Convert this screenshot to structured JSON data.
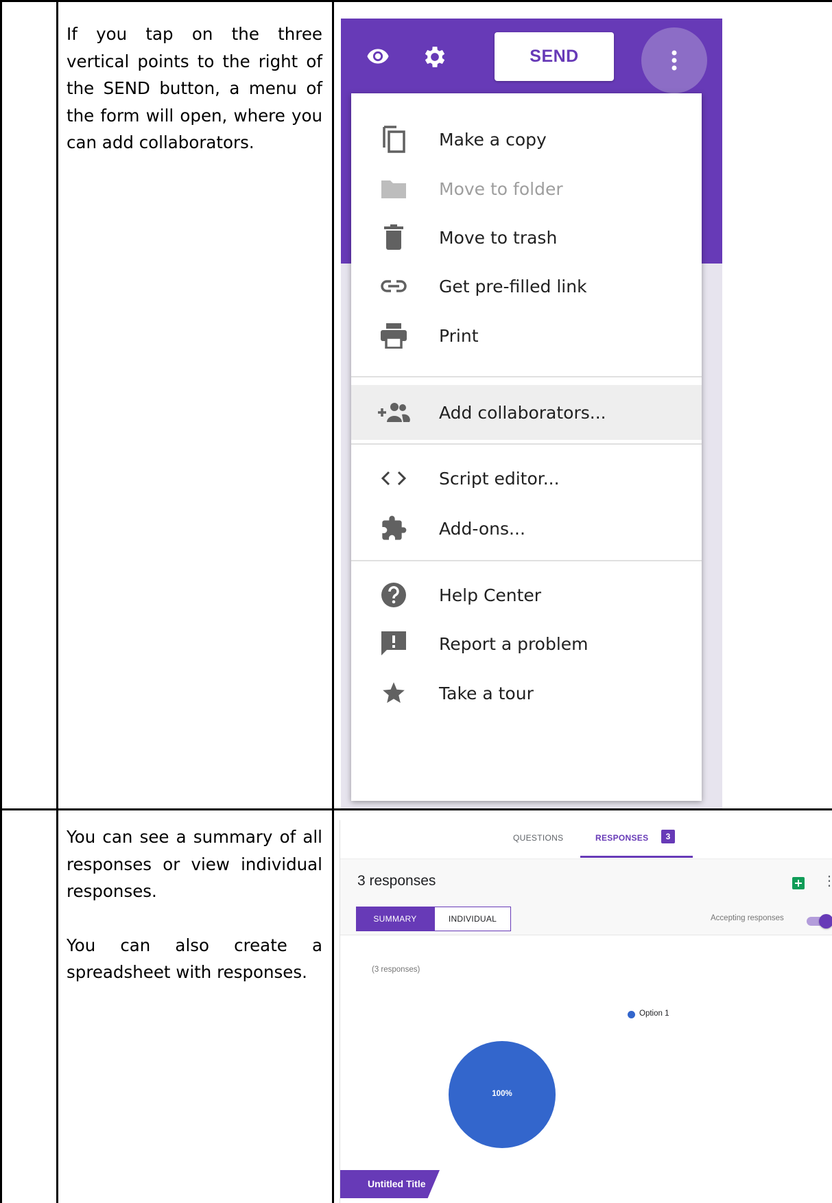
{
  "row1": {
    "text": "If you tap on the three vertical points to the right of the SEND button, a menu of the form will open, where you can add collaborators."
  },
  "row2": {
    "text1": "You can see a summary of all responses or view individual responses.",
    "text2": "You can also create a spreadsheet with responses."
  },
  "form_menu": {
    "toolbar": {
      "preview_icon": "eye-icon",
      "settings_icon": "gear-icon",
      "send_label": "SEND",
      "more_icon": "vertical-dots-icon"
    },
    "items": [
      {
        "label": "Make a copy",
        "icon": "copy-icon",
        "disabled": false
      },
      {
        "label": "Move to folder",
        "icon": "folder-icon",
        "disabled": true
      },
      {
        "label": "Move to trash",
        "icon": "trash-icon",
        "disabled": false
      },
      {
        "label": "Get pre-filled link",
        "icon": "link-icon",
        "disabled": false
      },
      {
        "label": "Print",
        "icon": "printer-icon",
        "disabled": false
      },
      {
        "label": "Add collaborators...",
        "icon": "add-people-icon",
        "highlighted": true
      },
      {
        "label": "Script editor...",
        "icon": "code-icon"
      },
      {
        "label": "Add-ons...",
        "icon": "puzzle-icon"
      },
      {
        "label": "Help Center",
        "icon": "help-icon"
      },
      {
        "label": "Report a problem",
        "icon": "feedback-icon"
      },
      {
        "label": "Take a tour",
        "icon": "star-icon"
      }
    ],
    "colors": {
      "accent": "#673ab7",
      "icon": "#616161"
    }
  },
  "responses_view": {
    "tabs": {
      "questions": "QUESTIONS",
      "responses": "RESPONSES",
      "responses_badge": "3"
    },
    "count_title": "3 responses",
    "segments": {
      "summary": "SUMMARY",
      "individual": "INDIVIDUAL"
    },
    "accepting_label": "Accepting responses",
    "accepting_on": true,
    "question_count": "(3 responses)",
    "form_title": "Untitled Title"
  },
  "chart_data": {
    "type": "pie",
    "categories": [
      "Option 1"
    ],
    "values": [
      100
    ],
    "slice_labels": [
      "100%"
    ],
    "legend": [
      "Option 1"
    ],
    "legend_position": "right",
    "colors": [
      "#3366cc"
    ]
  }
}
